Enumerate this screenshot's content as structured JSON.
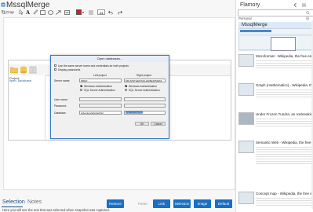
{
  "app": {
    "title": "MssqlMerge",
    "toolbar": {
      "crop_label": "Crop"
    }
  },
  "inner_app": {
    "panel_label": "Project",
    "panel_item": "Open Database"
  },
  "dialog": {
    "title": "Open databases...",
    "checkbox_same_server": "Use the same server name and credentials for both projects",
    "checkbox_display_passwords": "Display passwords",
    "left_header": "Left project",
    "right_header": "Right project",
    "server_label": "Server name:",
    "server_left": "NBHP",
    "server_right": "NB-WINTHEP\\SQL2005EXPRESS",
    "auth_windows": "Windows Authentication",
    "auth_sql": "SQL Server Authentication",
    "user_label": "User name:",
    "password_label": "Password:",
    "database_label": "Database:",
    "database_left": "AdventureWorks2012",
    "database_right": "AdventureWorks",
    "ok_label": "OK",
    "cancel_label": "Cancel"
  },
  "bottom": {
    "tab_selection": "Selection",
    "tab_notes": "Notes",
    "status_text": "Here you will see the text that was selected when snapshot was captured.",
    "restore_label": "Restore",
    "paste_label": "Paste:",
    "link_label": "Link",
    "selection_label": "Selection",
    "image_label": "Image",
    "default_label": "Default"
  },
  "sidebar": {
    "title": "Flamory",
    "personal_label": "Personal",
    "items": [
      {
        "title": "MssqlMerge",
        "desc": ""
      },
      {
        "title": "Microformat - Wikipedia, the free encyclopedi",
        "desc": ""
      },
      {
        "title": "Graph (mathematics) - Wikipedia, the free encycl",
        "desc": ""
      },
      {
        "title": "Under Frozen Tundra, an Icebreaking Ship Unco",
        "desc": ""
      },
      {
        "title": "Semantic Web - Wikipedia, the free encycloped",
        "desc": ""
      },
      {
        "title": "Concept map - Wikipedia, the free encycloped",
        "desc": ""
      }
    ]
  },
  "colors": {
    "accent": "#1a6fc4",
    "tab_active": "#1a4f8a",
    "dialog_border": "#3a7cc4",
    "record_red": "#d11f1f"
  }
}
